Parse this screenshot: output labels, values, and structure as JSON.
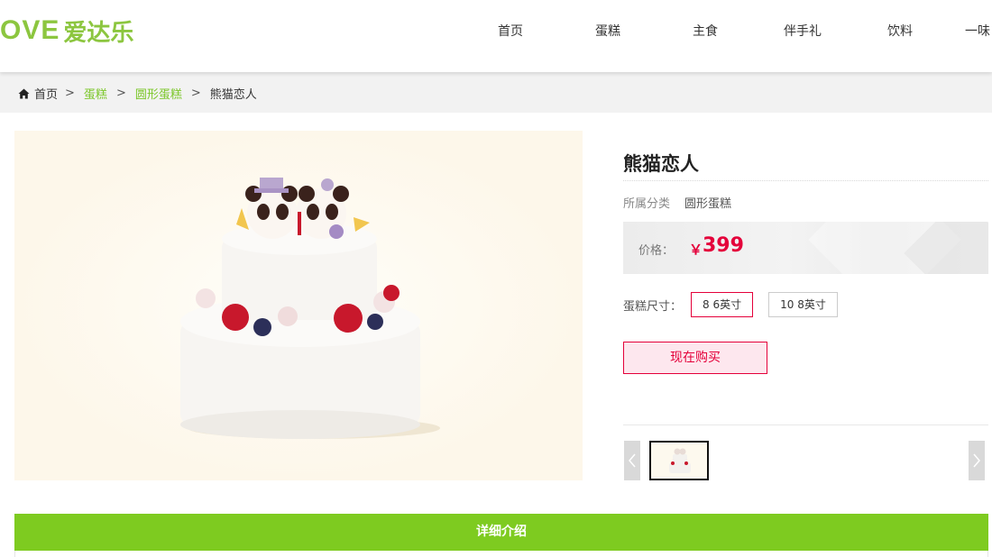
{
  "header": {
    "logo_en": "OVE",
    "logo_cn": "爱达乐",
    "nav": [
      {
        "label": "首页"
      },
      {
        "label": "蛋糕"
      },
      {
        "label": "主食"
      },
      {
        "label": "伴手礼"
      },
      {
        "label": "饮料"
      },
      {
        "label": "一味"
      }
    ]
  },
  "breadcrumb": {
    "home": "首页",
    "sep": ">",
    "items": [
      "蛋糕",
      "圆形蛋糕"
    ],
    "current": "熊猫恋人",
    "home_icon": "home-icon"
  },
  "product": {
    "title": "熊猫恋人",
    "category_label": "所属分类",
    "category_value": "圆形蛋糕",
    "price_label": "价格：",
    "currency": "￥",
    "price": "399",
    "size_label": "蛋糕尺寸：",
    "sizes": [
      {
        "label": "8 6英寸",
        "selected": true
      },
      {
        "label": "10 8英寸",
        "selected": false
      }
    ],
    "buy_label": "现在购买"
  },
  "detail": {
    "tab_label": "详细介绍"
  },
  "colors": {
    "brand_green": "#7ecb20",
    "price_red": "#e4003a"
  }
}
